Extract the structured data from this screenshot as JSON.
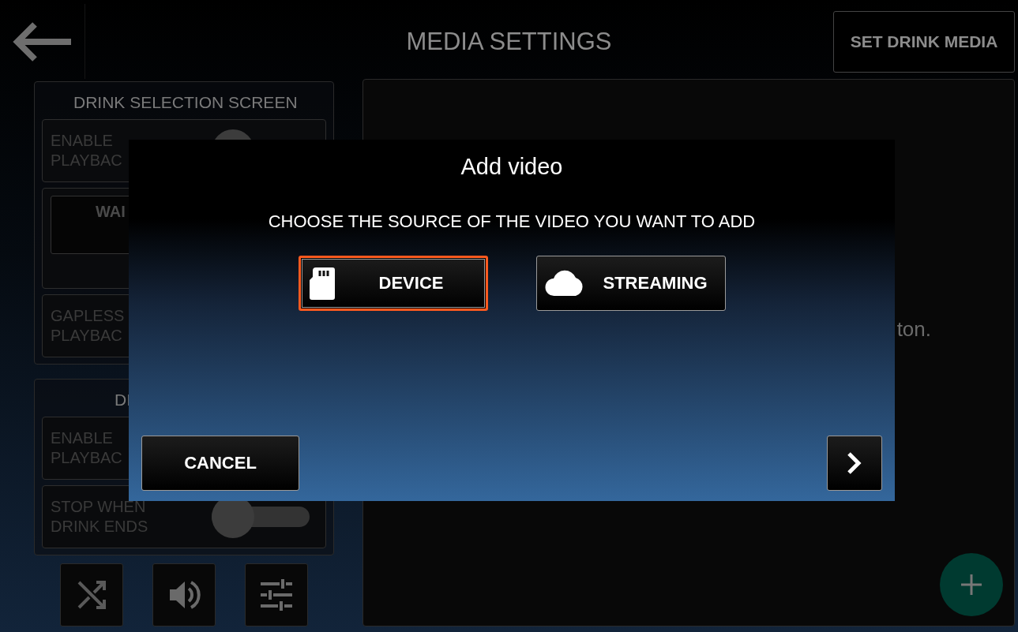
{
  "header": {
    "title": "MEDIA SETTINGS",
    "action_button": "SET DRINK MEDIA"
  },
  "sidebar": {
    "sections": [
      {
        "title": "DRINK SELECTION SCREEN",
        "rows": [
          {
            "kind": "toggle",
            "label": "ENABLE PLAYBAC",
            "on": false
          },
          {
            "kind": "button",
            "label": "WAI"
          },
          {
            "kind": "text",
            "label": "GAPLESS PLAYBAC"
          }
        ]
      },
      {
        "title": "DI",
        "rows": [
          {
            "kind": "text",
            "label": "ENABLE PLAYBAC"
          },
          {
            "kind": "toggle",
            "label": "STOP WHEN DRINK ENDS",
            "on": false
          }
        ]
      }
    ]
  },
  "content": {
    "hint": "ton."
  },
  "dialog": {
    "title": "Add video",
    "prompt": "CHOOSE THE SOURCE OF THE VIDEO YOU WANT TO ADD",
    "sources": [
      {
        "kind": "device",
        "label": "DEVICE",
        "selected": true
      },
      {
        "kind": "streaming",
        "label": "STREAMING",
        "selected": false
      }
    ],
    "cancel": "CANCEL"
  }
}
